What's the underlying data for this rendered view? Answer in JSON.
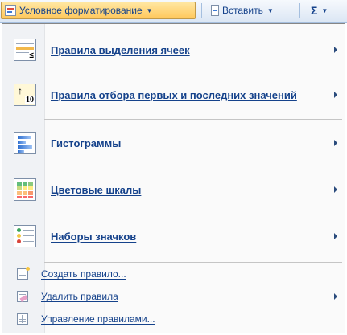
{
  "toolbar": {
    "active_label": "Условное форматирование",
    "insert_label": "Вставить",
    "sigma_label": "Σ"
  },
  "menu": {
    "items": [
      {
        "label": "Правила выделения ячеек",
        "icon": "highlight-cells-rules-icon",
        "has_submenu": true
      },
      {
        "label": "Правила отбора первых и последних значений",
        "icon": "top-bottom-rules-icon",
        "has_submenu": true
      },
      {
        "label": "Гистограммы",
        "icon": "data-bars-icon",
        "has_submenu": true
      },
      {
        "label": "Цветовые шкалы",
        "icon": "color-scales-icon",
        "has_submenu": true
      },
      {
        "label": "Наборы значков",
        "icon": "icon-sets-icon",
        "has_submenu": true
      }
    ],
    "small_items": [
      {
        "label": "Создать правило...",
        "icon": "new-rule-icon",
        "has_submenu": false
      },
      {
        "label": "Удалить правила",
        "icon": "clear-rules-icon",
        "has_submenu": true
      },
      {
        "label": "Управление правилами...",
        "icon": "manage-rules-icon",
        "has_submenu": false
      }
    ],
    "icon_glyphs": {
      "small_icon_text": "≤",
      "top_icon_text": "10"
    }
  },
  "colors": {
    "accent": "#15428b",
    "active_button_top": "#ffe7a2",
    "active_button_bottom": "#ffc85c",
    "menu_border": "#868686"
  }
}
